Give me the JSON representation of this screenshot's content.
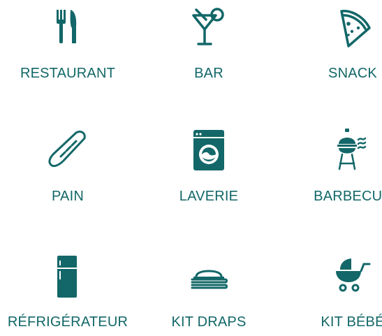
{
  "accent_color": "#136768",
  "services": [
    {
      "label": "RESTAURANT",
      "icon": "fork-knife-icon"
    },
    {
      "label": "BAR",
      "icon": "cocktail-glass-icon"
    },
    {
      "label": "SNACK",
      "icon": "pizza-slice-icon"
    },
    {
      "label": "PAIN",
      "icon": "baguette-icon"
    },
    {
      "label": "LAVERIE",
      "icon": "washing-machine-icon"
    },
    {
      "label": "BARBECUE",
      "icon": "barbecue-grill-icon"
    },
    {
      "label": "RÉFRIGÉRATEUR",
      "icon": "refrigerator-icon"
    },
    {
      "label": "KIT DRAPS",
      "icon": "folded-sheets-icon"
    },
    {
      "label": "KIT BÉBÉ",
      "icon": "baby-stroller-icon"
    }
  ]
}
